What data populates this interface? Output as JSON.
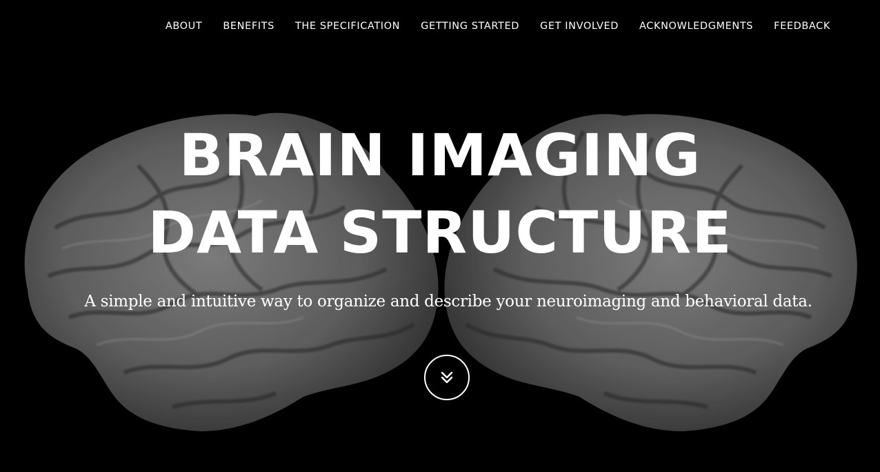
{
  "nav": {
    "items": [
      {
        "label": "ABOUT"
      },
      {
        "label": "BENEFITS"
      },
      {
        "label": "THE SPECIFICATION"
      },
      {
        "label": "GETTING STARTED"
      },
      {
        "label": "GET INVOLVED"
      },
      {
        "label": "ACKNOWLEDGMENTS"
      },
      {
        "label": "FEEDBACK"
      }
    ]
  },
  "hero": {
    "title_line1": "BRAIN IMAGING",
    "title_line2": "DATA STRUCTURE",
    "subtitle": "A simple and intuitive way to organize and describe your neuroimaging and behavioral data.",
    "scroll_icon": "double-chevron-down-icon",
    "background_image": "brain-hemispheres"
  },
  "colors": {
    "background": "#000000",
    "text": "#ffffff"
  }
}
